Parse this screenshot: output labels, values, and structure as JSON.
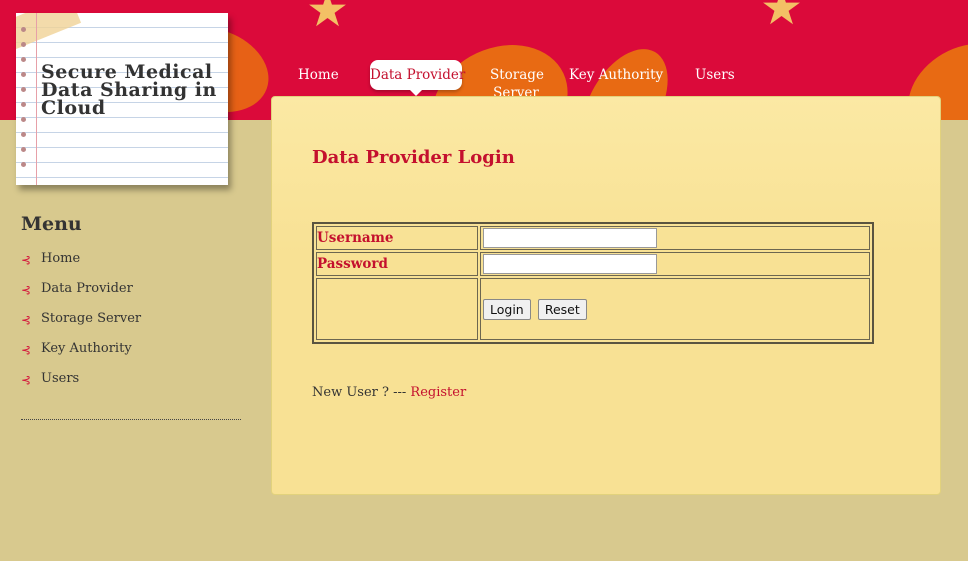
{
  "site": {
    "title": "Secure Medical Data Sharing in Cloud"
  },
  "topnav": [
    {
      "label": "Home"
    },
    {
      "label": "Data Provider"
    },
    {
      "label": "Storage Server"
    },
    {
      "label": "Key Authority"
    },
    {
      "label": "Users"
    }
  ],
  "topnav_active": "Data Provider",
  "sidebar": {
    "heading": "Menu",
    "items": [
      {
        "label": "Home"
      },
      {
        "label": "Data Provider"
      },
      {
        "label": "Storage Server"
      },
      {
        "label": "Key Authority"
      },
      {
        "label": "Users"
      }
    ]
  },
  "main": {
    "title": "Data Provider Login",
    "form": {
      "username_label": "Username",
      "password_label": "Password",
      "username_value": "",
      "password_value": "",
      "login_label": "Login",
      "reset_label": "Reset"
    },
    "new_user_text": "New User ? --- ",
    "register_label": "Register"
  },
  "colors": {
    "header_red": "#db0a3a",
    "accent_red": "#c4102e",
    "panel_yellow": "#f8e194",
    "background_tan": "#d8c98e"
  },
  "icons": {
    "sidebar_bullet": "arrow-bullet-icon",
    "decoration": "star-icon"
  }
}
